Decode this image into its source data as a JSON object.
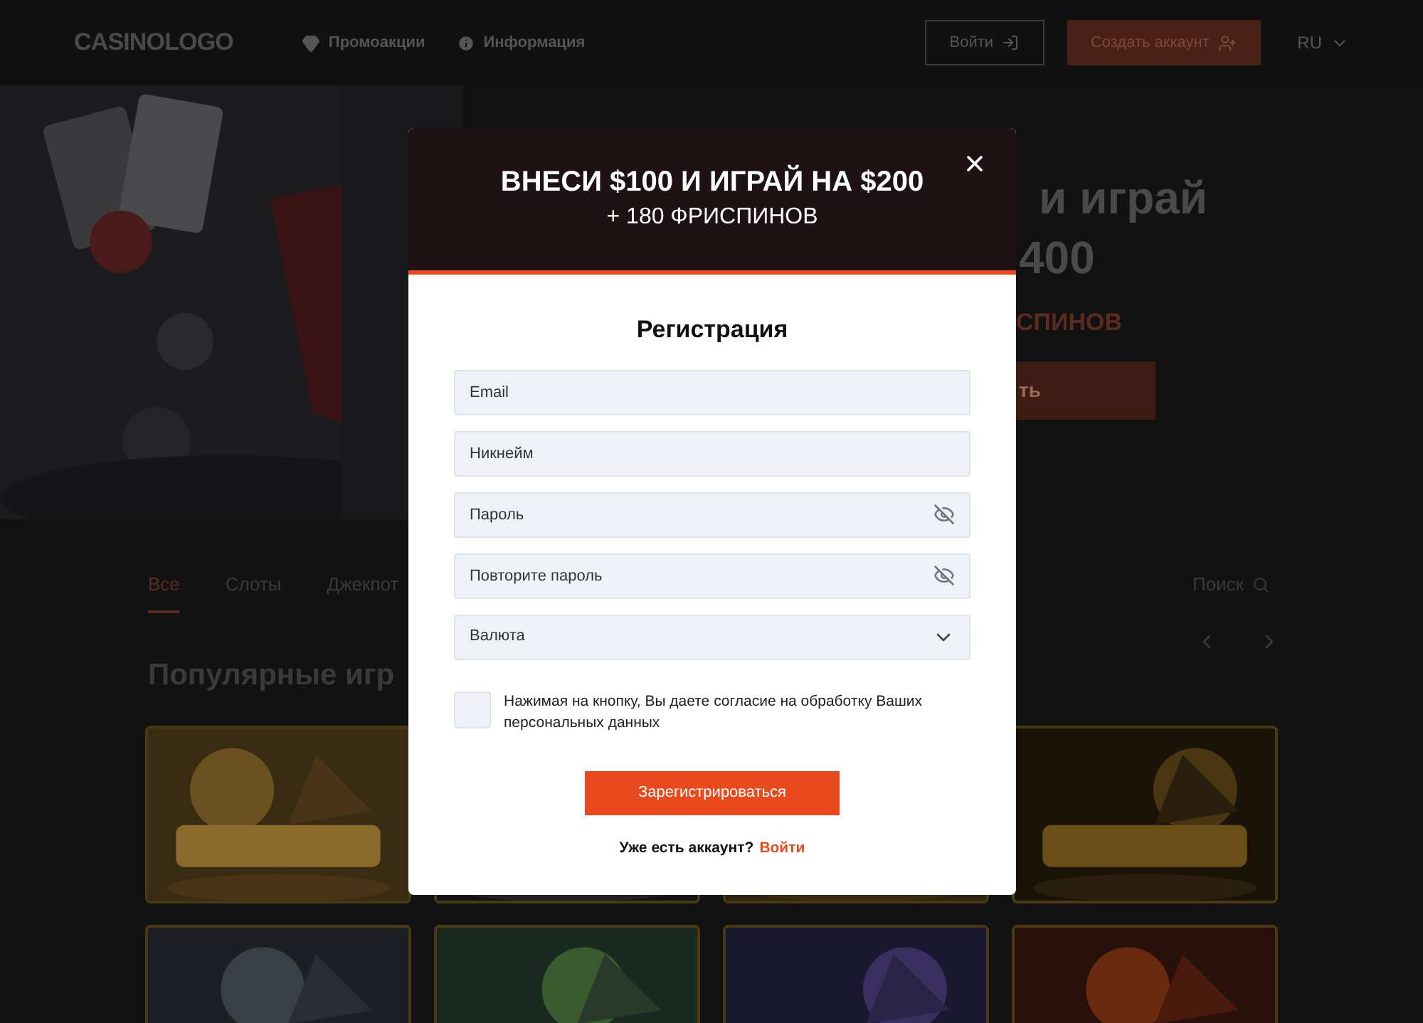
{
  "header": {
    "logo": "CASINOLOGO",
    "nav": [
      {
        "kind": "promo",
        "label": "Промоакции"
      },
      {
        "kind": "info",
        "label": "Информация"
      }
    ],
    "login_button": "Войти",
    "signup_button": "Создать аккаунт",
    "language": "RU"
  },
  "hero": {
    "headline": [
      "и играй",
      "400"
    ],
    "bonus": "СПИНОВ",
    "button": "ть"
  },
  "tabs": [
    {
      "label": "Все",
      "selected": true
    },
    {
      "label": "Слоты",
      "selected": false
    },
    {
      "label": "Джекпот",
      "selected": false
    }
  ],
  "search": "Поиск",
  "section_title": "Популярные игр",
  "modal": {
    "title": "ВНЕСИ $100 И ИГРАЙ НА $200",
    "subtitle": "+ 180 ФРИСПИНОВ",
    "heading": "Регистрация",
    "fields": [
      {
        "kind": "text",
        "placeholder": "Email"
      },
      {
        "kind": "text",
        "placeholder": "Никнейм"
      },
      {
        "kind": "password",
        "placeholder": "Пароль"
      },
      {
        "kind": "password",
        "placeholder": "Повторите пароль"
      },
      {
        "kind": "select",
        "placeholder": "Валюта"
      }
    ],
    "consent": {
      "text": "Нажимая на кнопку, Вы даете согласие на обработку Ваших персональных данных",
      "checked": false
    },
    "submit": "Зарегистрироваться",
    "footer": {
      "text": "Уже есть аккаунт?",
      "link": "Войти"
    }
  }
}
